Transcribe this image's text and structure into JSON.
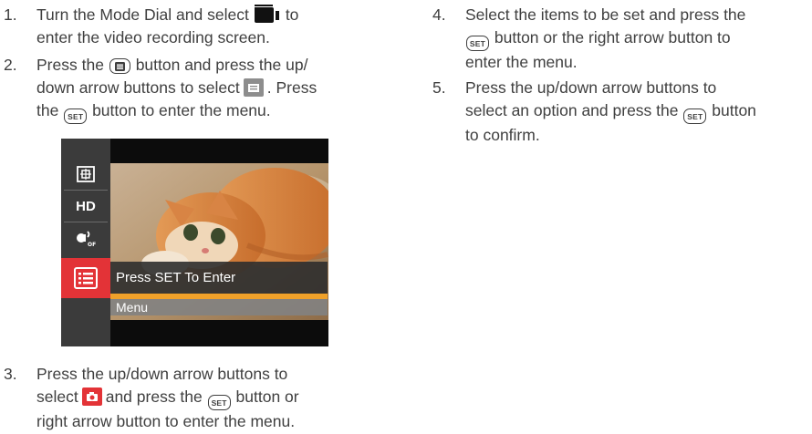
{
  "steps": [
    {
      "number": "1.",
      "line1_a": "Turn the Mode Dial and select",
      "line1_b": "to",
      "line2": "enter the video recording screen.",
      "icon": "video-mode-icon"
    },
    {
      "number": "2.",
      "line1_a": "Press the",
      "line1_b": "button and press the up/",
      "line2_a": "down arrow buttons to select",
      "line2_b": ". Press",
      "line3_a": "the",
      "line3_b": "button to enter the menu.",
      "icons": [
        "menu-button-icon",
        "menu-tile-icon",
        "set-button-icon"
      ]
    },
    {
      "number": "3.",
      "line1": "Press the up/down arrow buttons to",
      "line2_a": "select",
      "line2_b": "and press the",
      "line2_c": "button or",
      "line3": "right arrow button to enter the menu.",
      "icons": [
        "camera-tile-icon",
        "set-button-icon"
      ]
    },
    {
      "number": "4.",
      "line1": "Select the items to be set and press the",
      "line2": "button or the right arrow button to",
      "line3": "enter the menu.",
      "icons": [
        "set-button-icon"
      ]
    },
    {
      "number": "5.",
      "line1": "Press the up/down arrow buttons to",
      "line2_a": "select an option and press the",
      "line2_b": "button",
      "line3": "to confirm.",
      "icons": [
        "set-button-icon"
      ]
    }
  ],
  "key_labels": {
    "set": "SET"
  },
  "screen": {
    "sidebar": [
      "exposure-metering-icon",
      "HD",
      "wind-cut-off-icon",
      "menu-list-icon"
    ],
    "sidebar_hd_text": "HD",
    "overlay_title": "Press SET To Enter",
    "overlay_sub": "Menu",
    "colors": {
      "active": "#e33337",
      "highlight": "#f0a12a",
      "sidebar": "#3b3b3b"
    }
  }
}
